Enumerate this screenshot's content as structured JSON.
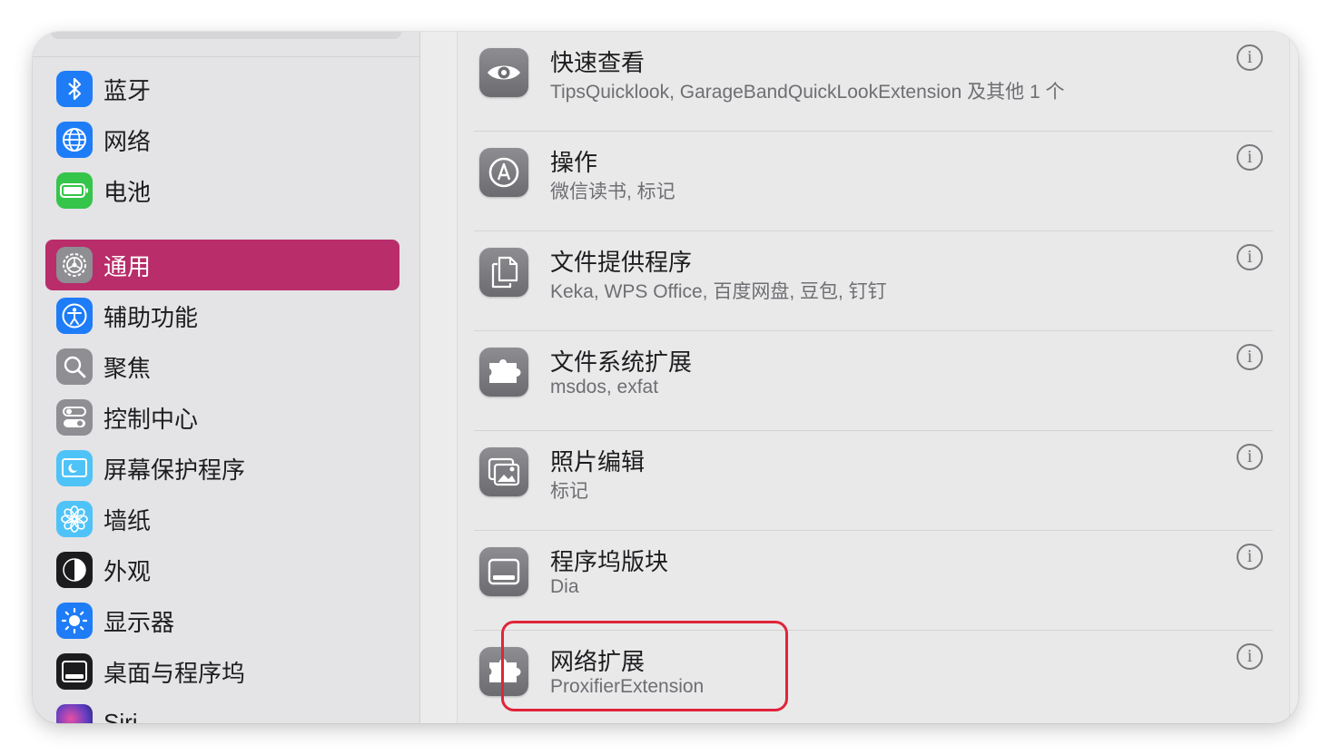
{
  "sidebar": {
    "items": [
      {
        "label": "蓝牙",
        "icon": "bluetooth-icon",
        "color": "#1e7cf7"
      },
      {
        "label": "网络",
        "icon": "globe-icon",
        "color": "#1e7cf7"
      },
      {
        "label": "电池",
        "icon": "battery-icon",
        "color": "#35c54a"
      },
      {
        "label": "通用",
        "icon": "gear-icon",
        "color": "#8e8e93",
        "active": true
      },
      {
        "label": "辅助功能",
        "icon": "accessibility-icon",
        "color": "#1e7cf7"
      },
      {
        "label": "聚焦",
        "icon": "magnifier-icon",
        "color": "#8e8e93"
      },
      {
        "label": "控制中心",
        "icon": "toggles-icon",
        "color": "#8e8e93"
      },
      {
        "label": "屏幕保护程序",
        "icon": "screensaver-icon",
        "color": "#4fc3f7"
      },
      {
        "label": "墙纸",
        "icon": "flower-icon",
        "color": "#4fc3f7"
      },
      {
        "label": "外观",
        "icon": "appearance-icon",
        "color": "#1c1c1e"
      },
      {
        "label": "显示器",
        "icon": "sun-icon",
        "color": "#1e7cf7"
      },
      {
        "label": "桌面与程序坞",
        "icon": "dock-icon",
        "color": "#1c1c1e"
      },
      {
        "label": "Siri",
        "icon": "siri-icon",
        "color": "#3b3b6b"
      }
    ]
  },
  "extensions": [
    {
      "title": "快速查看",
      "subtitle": "TipsQuicklook, GarageBandQuickLookExtension 及其他 1 个",
      "icon": "eye-icon"
    },
    {
      "title": "操作",
      "subtitle": "微信读书, 标记",
      "icon": "markup-icon"
    },
    {
      "title": "文件提供程序",
      "subtitle": "Keka, WPS Office, 百度网盘, 豆包, 钉钉",
      "icon": "document-icon"
    },
    {
      "title": "文件系统扩展",
      "subtitle": "msdos, exfat",
      "icon": "puzzle-icon"
    },
    {
      "title": "照片编辑",
      "subtitle": "标记",
      "icon": "photo-icon"
    },
    {
      "title": "程序坞版块",
      "subtitle": "Dia",
      "icon": "dock-tile-icon"
    },
    {
      "title": "网络扩展",
      "subtitle": "ProxifierExtension",
      "icon": "puzzle-icon"
    }
  ],
  "info_label": "i",
  "accent": {
    "active": "#b82d6a",
    "highlight": "#e0243a"
  }
}
